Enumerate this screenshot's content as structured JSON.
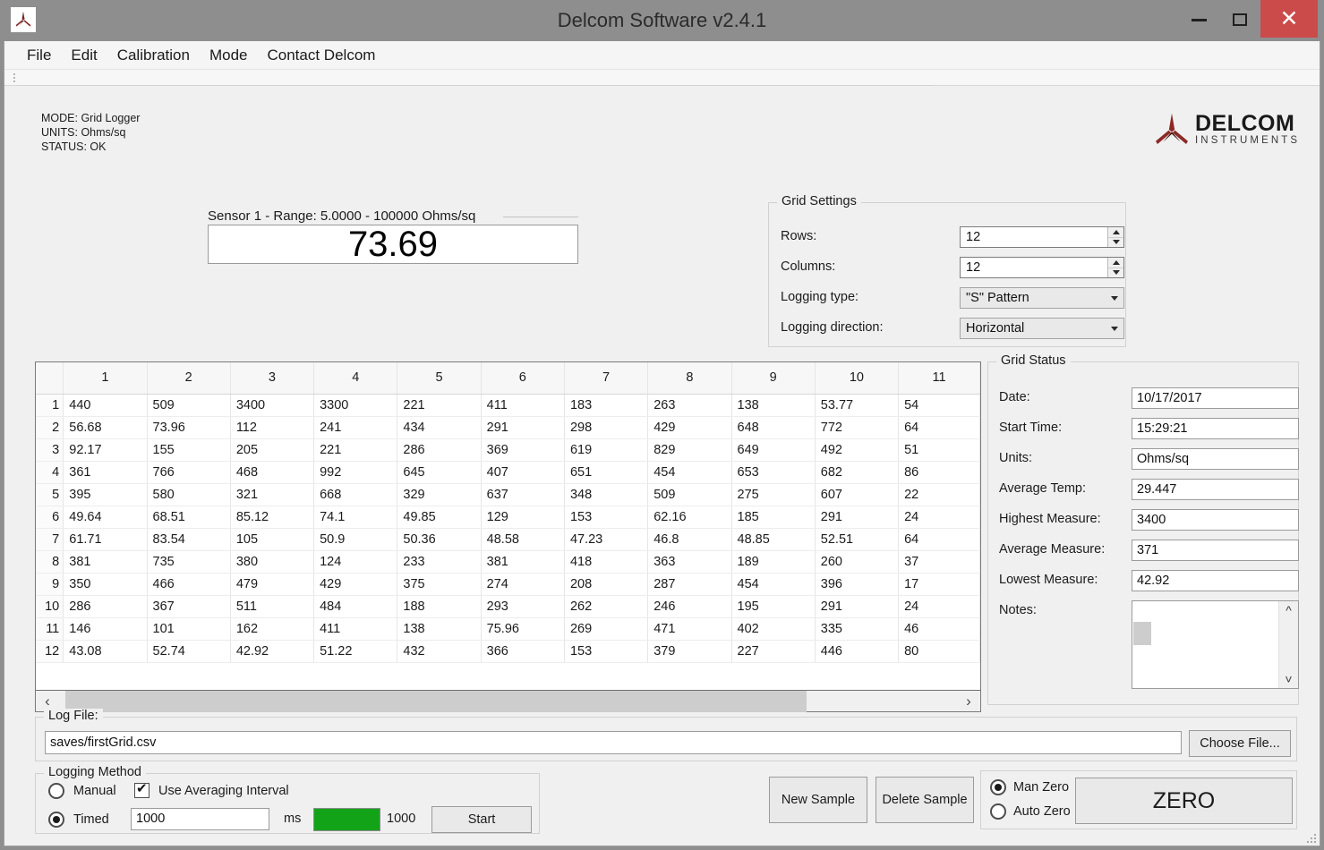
{
  "window": {
    "title": "Delcom Software v2.4.1",
    "app_icon": "delcom-trillium-icon",
    "minimize_label": "–",
    "maximize_label": "□",
    "close_label": "✕",
    "close_color": "#cb4b4b"
  },
  "menubar": {
    "items": [
      {
        "label": "File"
      },
      {
        "label": "Edit"
      },
      {
        "label": "Calibration"
      },
      {
        "label": "Mode"
      },
      {
        "label": "Contact Delcom"
      }
    ]
  },
  "status_block": {
    "mode": "MODE: Grid Logger",
    "units": "UNITS: Ohms/sq",
    "status": "STATUS: OK"
  },
  "logo": {
    "brand": "DELCOM",
    "tagline": "INSTRUMENTS",
    "mark_color": "#8c2a26"
  },
  "sensor": {
    "legend": "Sensor 1  -  Range: 5.0000 - 100000 Ohms/sq",
    "value": "73.69"
  },
  "grid_settings": {
    "legend": "Grid Settings",
    "rows_label": "Rows:",
    "rows_value": "12",
    "columns_label": "Columns:",
    "columns_value": "12",
    "logging_type_label": "Logging type:",
    "logging_type_value": "\"S\" Pattern",
    "logging_direction_label": "Logging direction:",
    "logging_direction_value": "Horizontal"
  },
  "data_grid": {
    "columns": [
      "1",
      "2",
      "3",
      "4",
      "5",
      "6",
      "7",
      "8",
      "9",
      "10",
      "11"
    ],
    "row_headers": [
      "1",
      "2",
      "3",
      "4",
      "5",
      "6",
      "7",
      "8",
      "9",
      "10",
      "11",
      "12"
    ],
    "rows": [
      [
        "440",
        "509",
        "3400",
        "3300",
        "221",
        "411",
        "183",
        "263",
        "138",
        "53.77",
        "54"
      ],
      [
        "56.68",
        "73.96",
        "112",
        "241",
        "434",
        "291",
        "298",
        "429",
        "648",
        "772",
        "64"
      ],
      [
        "92.17",
        "155",
        "205",
        "221",
        "286",
        "369",
        "619",
        "829",
        "649",
        "492",
        "51"
      ],
      [
        "361",
        "766",
        "468",
        "992",
        "645",
        "407",
        "651",
        "454",
        "653",
        "682",
        "86"
      ],
      [
        "395",
        "580",
        "321",
        "668",
        "329",
        "637",
        "348",
        "509",
        "275",
        "607",
        "22"
      ],
      [
        "49.64",
        "68.51",
        "85.12",
        "74.1",
        "49.85",
        "129",
        "153",
        "62.16",
        "185",
        "291",
        "24"
      ],
      [
        "61.71",
        "83.54",
        "105",
        "50.9",
        "50.36",
        "48.58",
        "47.23",
        "46.8",
        "48.85",
        "52.51",
        "64"
      ],
      [
        "381",
        "735",
        "380",
        "124",
        "233",
        "381",
        "418",
        "363",
        "189",
        "260",
        "37"
      ],
      [
        "350",
        "466",
        "479",
        "429",
        "375",
        "274",
        "208",
        "287",
        "454",
        "396",
        "17"
      ],
      [
        "286",
        "367",
        "511",
        "484",
        "188",
        "293",
        "262",
        "246",
        "195",
        "291",
        "24"
      ],
      [
        "146",
        "101",
        "162",
        "411",
        "138",
        "75.96",
        "269",
        "471",
        "402",
        "335",
        "46"
      ],
      [
        "43.08",
        "52.74",
        "42.92",
        "51.22",
        "432",
        "366",
        "153",
        "379",
        "227",
        "446",
        "80"
      ]
    ],
    "scroll_left_icon": "‹",
    "scroll_right_icon": "›"
  },
  "grid_status": {
    "legend": "Grid Status",
    "fields": [
      {
        "label": "Date:",
        "value": "10/17/2017"
      },
      {
        "label": "Start Time:",
        "value": "15:29:21"
      },
      {
        "label": "Units:",
        "value": "Ohms/sq"
      },
      {
        "label": "Average Temp:",
        "value": "29.447"
      },
      {
        "label": "Highest Measure:",
        "value": "3400"
      },
      {
        "label": "Average Measure:",
        "value": "371"
      },
      {
        "label": "Lowest Measure:",
        "value": "42.92"
      }
    ],
    "notes_label": "Notes:",
    "notes_value": ""
  },
  "log_file": {
    "legend": "Log File:",
    "path": "saves/firstGrid.csv",
    "choose_label": "Choose File..."
  },
  "logging_method": {
    "legend": "Logging Method",
    "manual_label": "Manual",
    "manual_selected": false,
    "timed_label": "Timed",
    "timed_selected": true,
    "averaging_label": "Use Averaging Interval",
    "averaging_checked": true,
    "interval_value": "1000",
    "ms_label": "ms",
    "progress_value": "1000",
    "progress_color": "#13a319",
    "start_label": "Start"
  },
  "actions": {
    "new_sample_label": "New Sample",
    "delete_sample_label": "Delete Sample",
    "man_zero_label": "Man Zero",
    "man_zero_selected": true,
    "auto_zero_label": "Auto Zero",
    "auto_zero_selected": false,
    "zero_label": "ZERO"
  }
}
